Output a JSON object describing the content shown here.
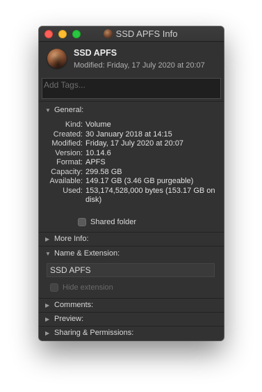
{
  "window": {
    "title": "SSD APFS Info"
  },
  "header": {
    "name": "SSD APFS",
    "modified": "Modified: Friday, 17 July 2020 at 20:07"
  },
  "tags": {
    "placeholder": "Add Tags..."
  },
  "sections": {
    "general": "General:",
    "more_info": "More Info:",
    "name_extension": "Name & Extension:",
    "comments": "Comments:",
    "preview": "Preview:",
    "sharing": "Sharing & Permissions:"
  },
  "general": {
    "rows": [
      {
        "key": "Kind:",
        "value": "Volume"
      },
      {
        "key": "Created:",
        "value": "30 January 2018 at 14:15"
      },
      {
        "key": "Modified:",
        "value": "Friday, 17 July 2020 at 20:07"
      },
      {
        "key": "Version:",
        "value": "10.14.6"
      },
      {
        "key": "Format:",
        "value": "APFS"
      },
      {
        "key": "Capacity:",
        "value": "299.58 GB"
      },
      {
        "key": "Available:",
        "value": "149.17 GB (3.46 GB purgeable)"
      },
      {
        "key": "Used:",
        "value": "153,174,528,000 bytes (153.17 GB on disk)"
      }
    ],
    "shared_folder_label": "Shared folder"
  },
  "name_extension": {
    "name_value": "SSD APFS",
    "hide_extension_label": "Hide extension"
  }
}
